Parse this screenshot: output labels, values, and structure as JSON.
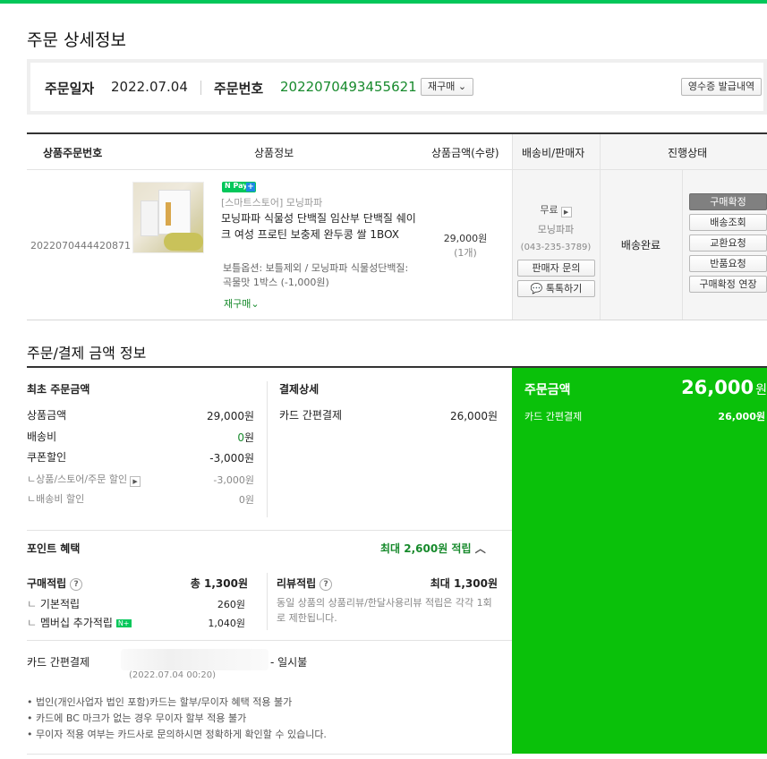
{
  "page_title": "주문 상세정보",
  "order_info": {
    "date_label": "주문일자",
    "date_value": "2022.07.04",
    "number_label": "주문번호",
    "number_value": "2022070493455621",
    "rebuy_button": "재구매",
    "receipt_button": "영수증 발급내역"
  },
  "table": {
    "headers": [
      "상품주문번호",
      "상품정보",
      "상품금액(수량)",
      "배송비/판매자",
      "진행상태"
    ],
    "row": {
      "item_order_no": "2022070444420871",
      "npay_label": "N Pay",
      "store": "[스마트스토어] 모닝파파",
      "product_name": "모닝파파 식물성 단백질 임산부 단백질 쉐이크 여성 프로틴 보충제 완두콩 쌀 1BOX",
      "option": "보틀옵션: 보틀제외 / 모닝파파 식물성단백질: 곡물맛 1박스 (-1,000원)",
      "rebuy": "재구매",
      "price": "29,000원",
      "qty": "(1개)",
      "shipping": "무료",
      "seller": "모닝파파",
      "seller_phone": "(043-235-3789)",
      "seller_inquiry": "판매자 문의",
      "talk_button": "톡톡하기",
      "status": "배송완료",
      "actions": [
        "구매확정",
        "배송조회",
        "교환요청",
        "반품요청",
        "구매확정 연장"
      ]
    }
  },
  "payment": {
    "section_title": "주문/결제 금액 정보",
    "original": {
      "title": "최초 주문금액",
      "product_label": "상품금액",
      "product_value": "29,000원",
      "shipping_label": "배송비",
      "shipping_value": "0",
      "shipping_unit": "원",
      "coupon_label": "쿠폰할인",
      "coupon_value": "-3,000원",
      "store_discount_label": "상품/스토어/주문 할인",
      "store_discount_value": "-3,000원",
      "ship_discount_label": "배송비 할인",
      "ship_discount_value": "0원"
    },
    "detail": {
      "title": "결제상세",
      "method_label": "카드 간편결제",
      "method_value": "26,000원"
    },
    "summary": {
      "total_label": "주문금액",
      "total_value": "26,000",
      "total_unit": "원",
      "method_label": "카드 간편결제",
      "method_value": "26,000원"
    },
    "points": {
      "title": "포인트 혜택",
      "max_label": "최대 2,600원 적립",
      "purchase_title": "구매적립",
      "purchase_total": "총 1,300원",
      "basic_label": "기본적립",
      "basic_value": "260원",
      "member_label": "멤버십 추가적립",
      "member_value": "1,040원",
      "review_title": "리뷰적립",
      "review_total": "최대 1,300원",
      "review_desc": "동일 상품의 상품리뷰/한달사용리뷰 적립은 각각 1회로 제한됩니다."
    },
    "card": {
      "label": "카드 간편결제",
      "installment": "- 일시불",
      "datetime": "(2022.07.04 00:20)"
    },
    "notes": [
      "• 법인(개인사업자 법인 포함)카드는 할부/무이자 혜택 적용 불가",
      "• 카드에 BC 마크가 없는 경우 무이자 할부 적용 불가",
      "• 무이자 적용 여부는 카드사로 문의하시면 정확하게 확인할 수 있습니다."
    ]
  },
  "colors": {
    "accent": "#03c75a",
    "summary_bg": "#0ac10a",
    "point_green": "#178a2c"
  }
}
